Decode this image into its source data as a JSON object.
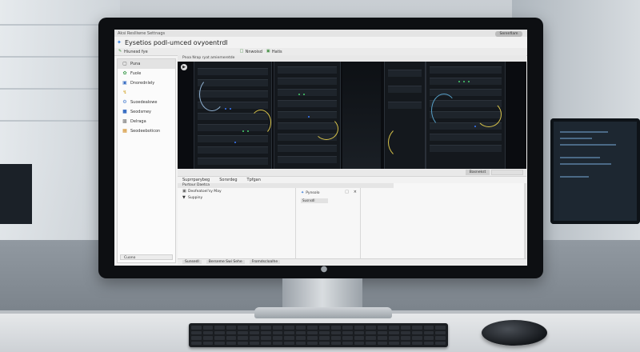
{
  "window": {
    "title": "Aksi Reslliwne Settnags",
    "account_button": "Serenfiam Siten",
    "app_name": "Eysetios podl-umced ovyoentrdl"
  },
  "toolbar": {
    "items": [
      {
        "label": "Hiunesd fye",
        "icon": "edit-icon"
      },
      {
        "label": "Nnwoisd",
        "icon": "document-icon"
      },
      {
        "label": "Hatis",
        "icon": "folder-icon"
      }
    ]
  },
  "sidebar": {
    "items": [
      {
        "label": "Puna",
        "icon": "folder-icon"
      },
      {
        "label": "Fuole",
        "icon": "leaf-icon"
      },
      {
        "label": "Dnorednlely",
        "icon": "monitor-icon"
      },
      {
        "label": "",
        "icon": "bolt-icon"
      },
      {
        "label": "Suoedealowe",
        "icon": "gear-icon"
      },
      {
        "label": "Seodsmey",
        "icon": "lock-icon"
      },
      {
        "label": "Delraga",
        "icon": "image-icon"
      },
      {
        "label": "Seodeeboticon",
        "icon": "database-icon"
      }
    ],
    "footer": "Cuono"
  },
  "viewer": {
    "label": "Pnoa Nrap ryat amiemeretde",
    "play_icon": "play-icon"
  },
  "strip": {
    "button": "Basnekst"
  },
  "tabs": [
    "Suprrparybeg",
    "Sorsrdeg",
    "Tpfgan"
  ],
  "panel": {
    "subhead": "Purtour Daetca",
    "rows": [
      {
        "label": "Deofeatoel'sy May",
        "icon": "folder-icon"
      },
      {
        "label": "Suppiny",
        "icon": "caret-down-icon"
      }
    ],
    "detail_title": "Pynsolo",
    "detail_chip": "Susnsdl"
  },
  "status": {
    "segments": [
      "Sunsedl",
      "Berseme Swi Sehe",
      "Fromdscloalhe"
    ]
  },
  "colors": {
    "accent_blue": "#2d7be0",
    "led_blue": "#3d7bff",
    "led_green": "#47d16b",
    "cable_yellow": "#d8c34a"
  }
}
